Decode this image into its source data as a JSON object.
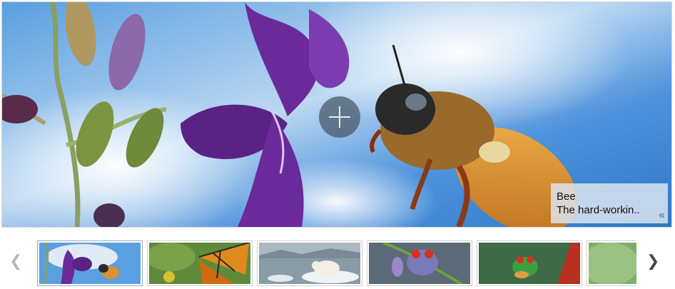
{
  "slide": {
    "title": "Bee",
    "description": "The hard-workin..",
    "collapse_glyph": "«"
  },
  "controls": {
    "zoom_icon": "plus-icon",
    "prev_glyph": "❮",
    "next_glyph": "❯"
  },
  "thumbnails": [
    {
      "subject": "bee-flower"
    },
    {
      "subject": "butterfly"
    },
    {
      "subject": "polar-bear"
    },
    {
      "subject": "tree-frog-blue"
    },
    {
      "subject": "tree-frog-green"
    },
    {
      "subject": "partial"
    }
  ],
  "colors": {
    "sky": "#3f8bd6",
    "flower_purple": "#7a2fa8",
    "bee_orange": "#d8922f",
    "caption_bg": "#dce4ee",
    "arrow_active": "#4a4a4a",
    "arrow_disabled": "#b7b7b7"
  }
}
